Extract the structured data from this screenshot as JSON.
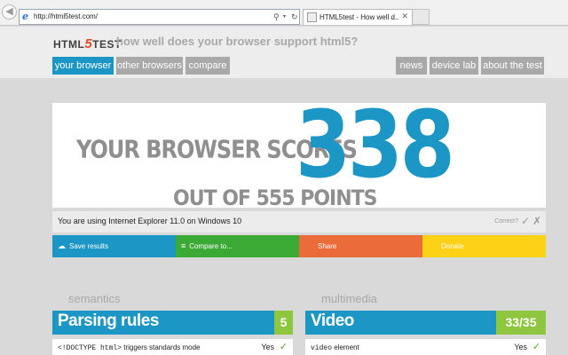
{
  "browser": {
    "url": "http://html5test.com/",
    "tab_title": "HTML5test - How well d...",
    "icons": [
      "back-arrow-icon",
      "forward-arrow-icon",
      "ie-logo-icon",
      "search-icon",
      "refresh-icon",
      "close-icon"
    ]
  },
  "header": {
    "logo_pre": "HTML",
    "logo_five": "5",
    "logo_post": "TEST",
    "tagline": "how well does your browser support html5?"
  },
  "nav": {
    "left": [
      "your browser",
      "other browsers",
      "compare"
    ],
    "right": [
      "news",
      "device lab",
      "about the test"
    ],
    "active": "your browser"
  },
  "score": {
    "label": "YOUR BROWSER SCORES",
    "value": "338",
    "out_of": "OUT OF 555 POINTS"
  },
  "using": {
    "text": "You are using Internet Explorer 11.0 on Windows 10",
    "correct_label": "Correct?",
    "check": "✓",
    "cross": "✗"
  },
  "actions": [
    {
      "label": "Save results",
      "icon": "cloud-icon",
      "color": "#1b96c5"
    },
    {
      "label": "Compare to...",
      "icon": "compare-icon",
      "color": "#3aaa35"
    },
    {
      "label": "Share",
      "icon": "",
      "color": "#ec6b3b"
    },
    {
      "label": "Donate",
      "icon": "",
      "color": "#fcd116"
    }
  ],
  "sections": {
    "left": {
      "heading": "semantics",
      "category": "Parsing rules",
      "score": "5",
      "row": {
        "code": "<!DOCTYPE html>",
        "text": " triggers standards mode",
        "result": "Yes",
        "check": "✓"
      }
    },
    "right": {
      "heading": "multimedia",
      "category": "Video",
      "score": "33/35",
      "row": {
        "code": "video",
        "text": " element",
        "result": "Yes",
        "check": "✓"
      }
    }
  },
  "colors": {
    "accent": "#1b96c5",
    "score_badge": "#8ec73f",
    "logo_five": "#e34c26"
  }
}
